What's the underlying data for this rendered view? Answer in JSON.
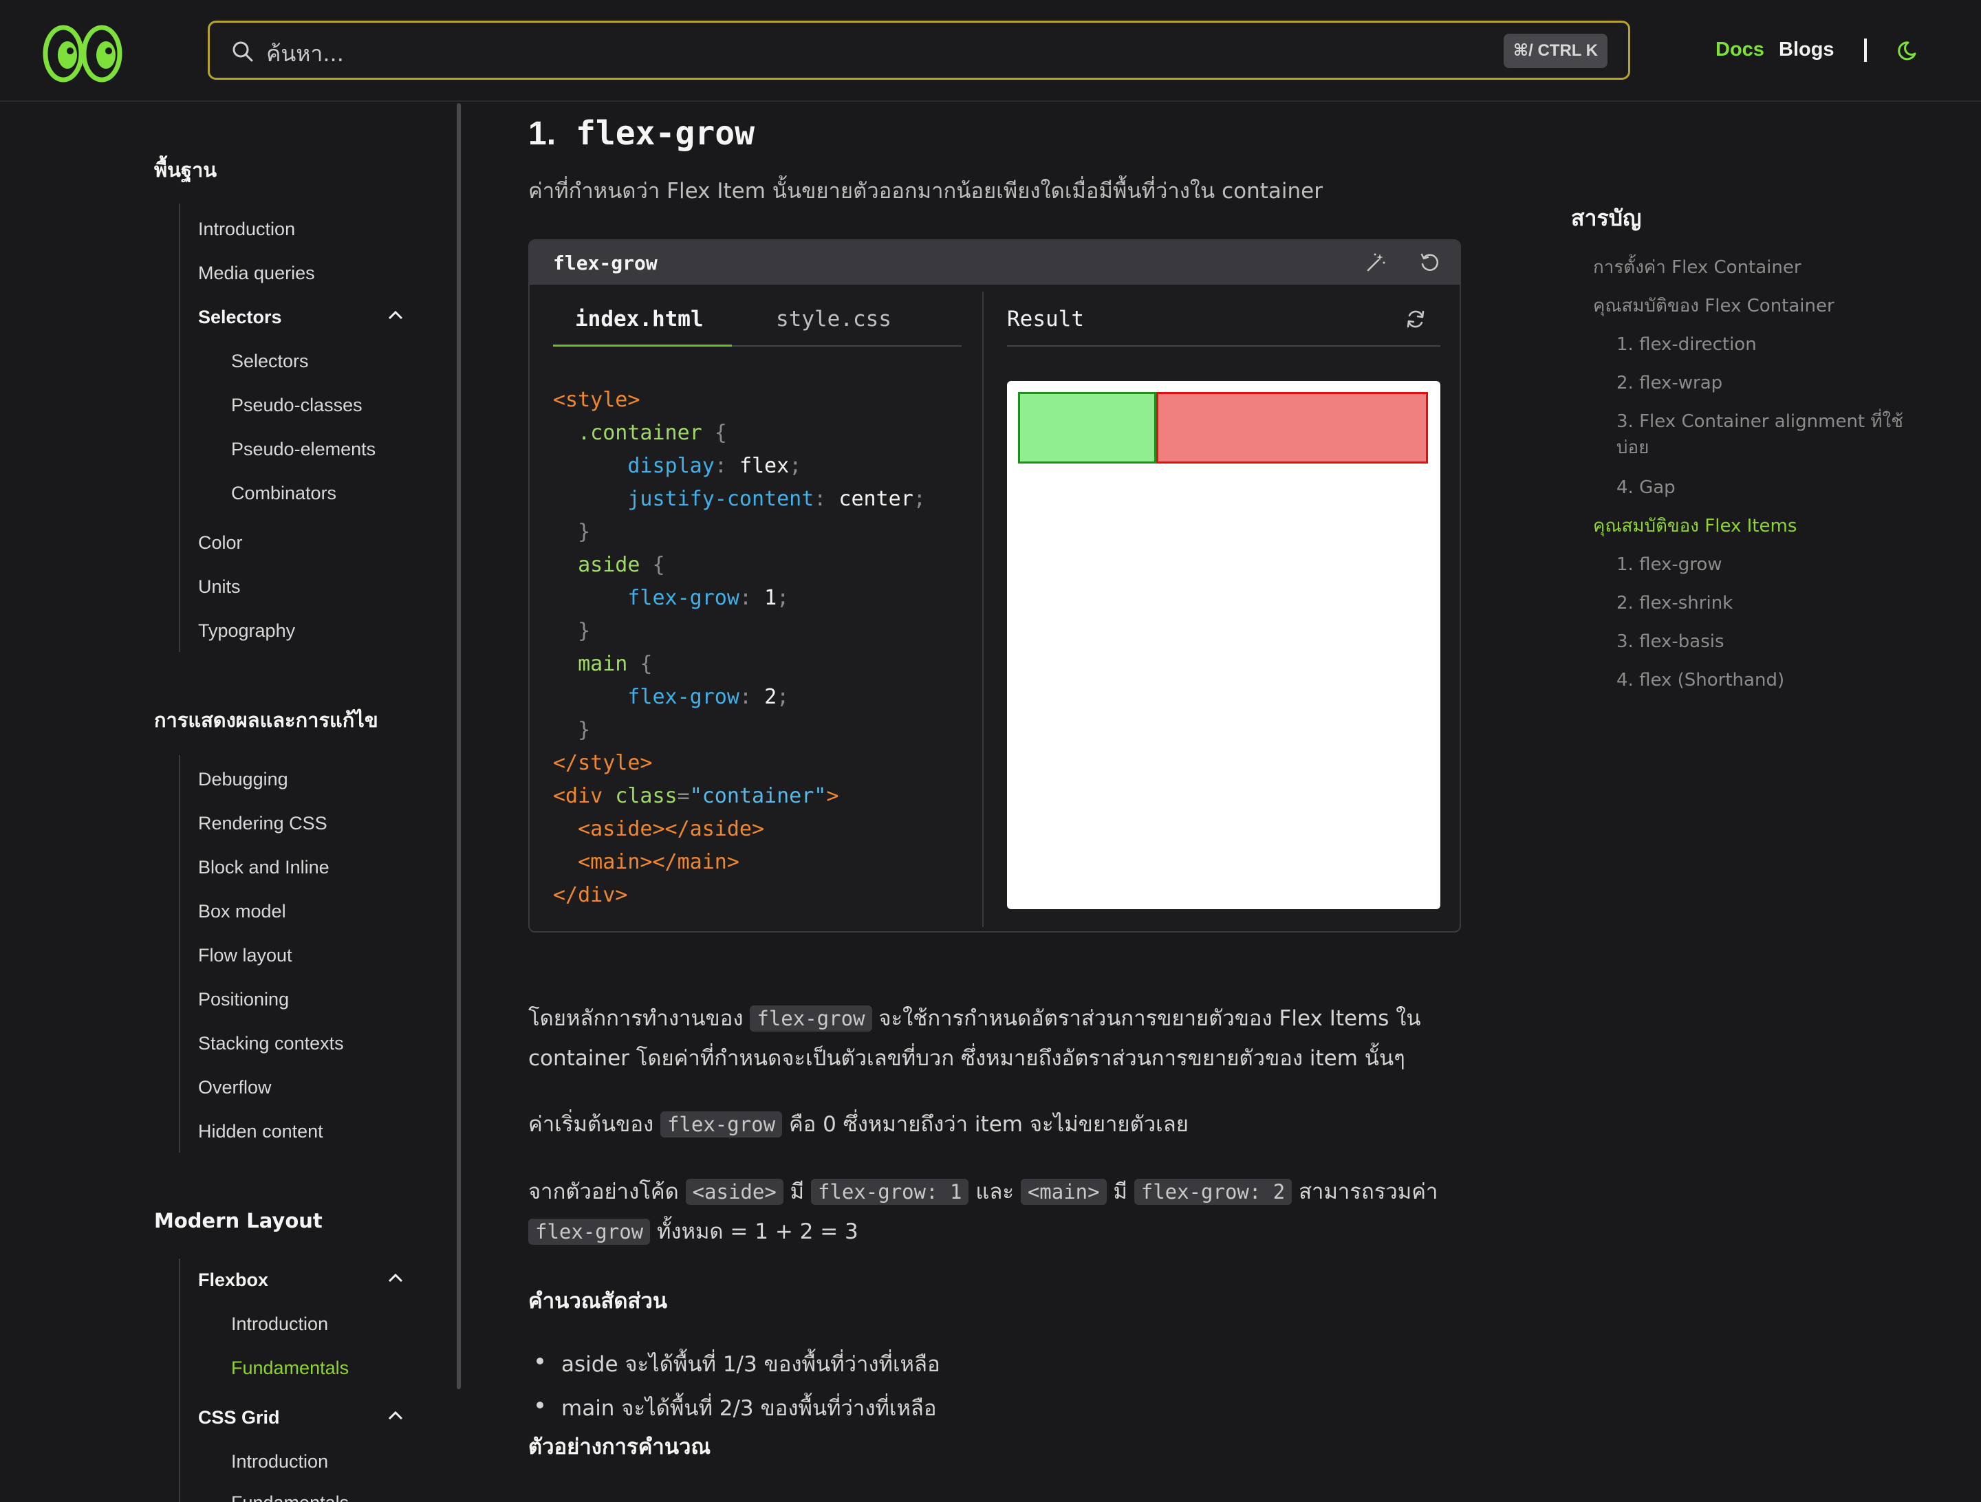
{
  "header": {
    "search_placeholder": "ค้นหา...",
    "shortcut": "⌘/ CTRL K",
    "nav_docs": "Docs",
    "nav_blogs": "Blogs",
    "accent_color": "#7ee03b"
  },
  "sidebar": {
    "sections": [
      {
        "title": "พื้นฐาน",
        "items": [
          "Introduction",
          "Media queries",
          "Selectors",
          "Color",
          "Units",
          "Typography"
        ],
        "selectors_group": {
          "label": "Selectors",
          "children": [
            "Selectors",
            "Pseudo-classes",
            "Pseudo-elements",
            "Combinators"
          ]
        }
      },
      {
        "title": "การแสดงผลและการแก้ไข",
        "items": [
          "Debugging",
          "Rendering CSS",
          "Block and Inline",
          "Box model",
          "Flow layout",
          "Positioning",
          "Stacking contexts",
          "Overflow",
          "Hidden content"
        ]
      },
      {
        "title": "Modern Layout",
        "flexbox": {
          "label": "Flexbox",
          "children": [
            "Introduction",
            "Fundamentals"
          ]
        },
        "grid": {
          "label": "CSS Grid",
          "children": [
            "Introduction",
            "Fundamentals"
          ]
        }
      }
    ]
  },
  "main": {
    "heading_num": "1.",
    "heading_code": "flex-grow",
    "lead": "ค่าที่กำหนดว่า Flex Item นั้นขยายตัวออกมากน้อยเพียงใดเมื่อมีพื้นที่ว่างใน container",
    "playground": {
      "title": "flex-grow",
      "tab_html": "index.html",
      "tab_css": "style.css",
      "result_label": "Result",
      "code_lines": [
        [
          [
            "c-tag",
            "<style>"
          ]
        ],
        [
          [
            "c-sel",
            "  .container"
          ],
          [
            "c-punc",
            " {"
          ]
        ],
        [
          [
            "c-prop",
            "      display"
          ],
          [
            "c-punc",
            ": "
          ],
          [
            "c-val",
            "flex"
          ],
          [
            "c-punc",
            ";"
          ]
        ],
        [
          [
            "c-prop",
            "      justify-content"
          ],
          [
            "c-punc",
            ": "
          ],
          [
            "c-val",
            "center"
          ],
          [
            "c-punc",
            ";"
          ]
        ],
        [
          [
            "c-punc",
            "  }"
          ]
        ],
        [
          [
            "c-sel",
            "  aside"
          ],
          [
            "c-punc",
            " {"
          ]
        ],
        [
          [
            "c-prop",
            "      flex-grow"
          ],
          [
            "c-punc",
            ": "
          ],
          [
            "c-val",
            "1"
          ],
          [
            "c-punc",
            ";"
          ]
        ],
        [
          [
            "c-punc",
            "  }"
          ]
        ],
        [
          [
            "c-sel",
            "  main"
          ],
          [
            "c-punc",
            " {"
          ]
        ],
        [
          [
            "c-prop",
            "      flex-grow"
          ],
          [
            "c-punc",
            ": "
          ],
          [
            "c-val",
            "2"
          ],
          [
            "c-punc",
            ";"
          ]
        ],
        [
          [
            "c-punc",
            "  }"
          ]
        ],
        [
          [
            "c-tag",
            "</style>"
          ]
        ],
        [
          [
            "c-tag",
            "<div "
          ],
          [
            "c-attr",
            "class"
          ],
          [
            "c-punc",
            "="
          ],
          [
            "c-str",
            "\"container\""
          ],
          [
            "c-tag",
            ">"
          ]
        ],
        [
          [
            "c-tag",
            "  <aside></aside>"
          ]
        ],
        [
          [
            "c-tag",
            "  <main></main>"
          ]
        ],
        [
          [
            "c-tag",
            "</div>"
          ]
        ]
      ],
      "demo": {
        "aside_grow": 1,
        "main_grow": 2,
        "aside_color": "#90ee90",
        "main_color": "#f08080"
      }
    },
    "p1_a": "โดยหลักการทำงานของ ",
    "p1_code": "flex-grow",
    "p1_b": " จะใช้การกำหนดอัตราส่วนการขยายตัวของ Flex Items ใน",
    "p1_c": "container โดยค่าที่กำหนดจะเป็นตัวเลขที่บวก ซึ่งหมายถึงอัตราส่วนการขยายตัวของ item นั้นๆ",
    "p2_a": "ค่าเริ่มต้นของ ",
    "p2_code": "flex-grow",
    "p2_b": " คือ 0 ซึ่งหมายถึงว่า item จะไม่ขยายตัวเลย",
    "p3_a": "จากตัวอย่างโค้ด ",
    "p3_c1": "<aside>",
    "p3_b": " มี ",
    "p3_c2": "flex-grow: 1",
    "p3_c": " และ ",
    "p3_c3": "<main>",
    "p3_d": " มี ",
    "p3_c4": "flex-grow: 2",
    "p3_e": " สามารถรวมค่า",
    "p3_c5": "flex-grow",
    "p3_f": " ทั้งหมด = 1 + 2 = 3",
    "h3_ratio": "คำนวณสัดส่วน",
    "bullets": [
      "aside จะได้พื้นที่ 1/3 ของพื้นที่ว่างที่เหลือ",
      "main จะได้พื้นที่ 2/3 ของพื้นที่ว่างที่เหลือ"
    ],
    "h3_example": "ตัวอย่างการคำนวณ"
  },
  "toc": {
    "title": "สารบัญ",
    "items": [
      "การตั้งค่า Flex Container",
      "คุณสมบัติของ Flex Container",
      "1. flex-direction",
      "2. flex-wrap",
      "3. Flex Container alignment ที่ใช้บ่อย",
      "4. Gap",
      "คุณสมบัติของ Flex Items",
      "1. flex-grow",
      "2. flex-shrink",
      "3. flex-basis",
      "4. flex (Shorthand)"
    ]
  }
}
